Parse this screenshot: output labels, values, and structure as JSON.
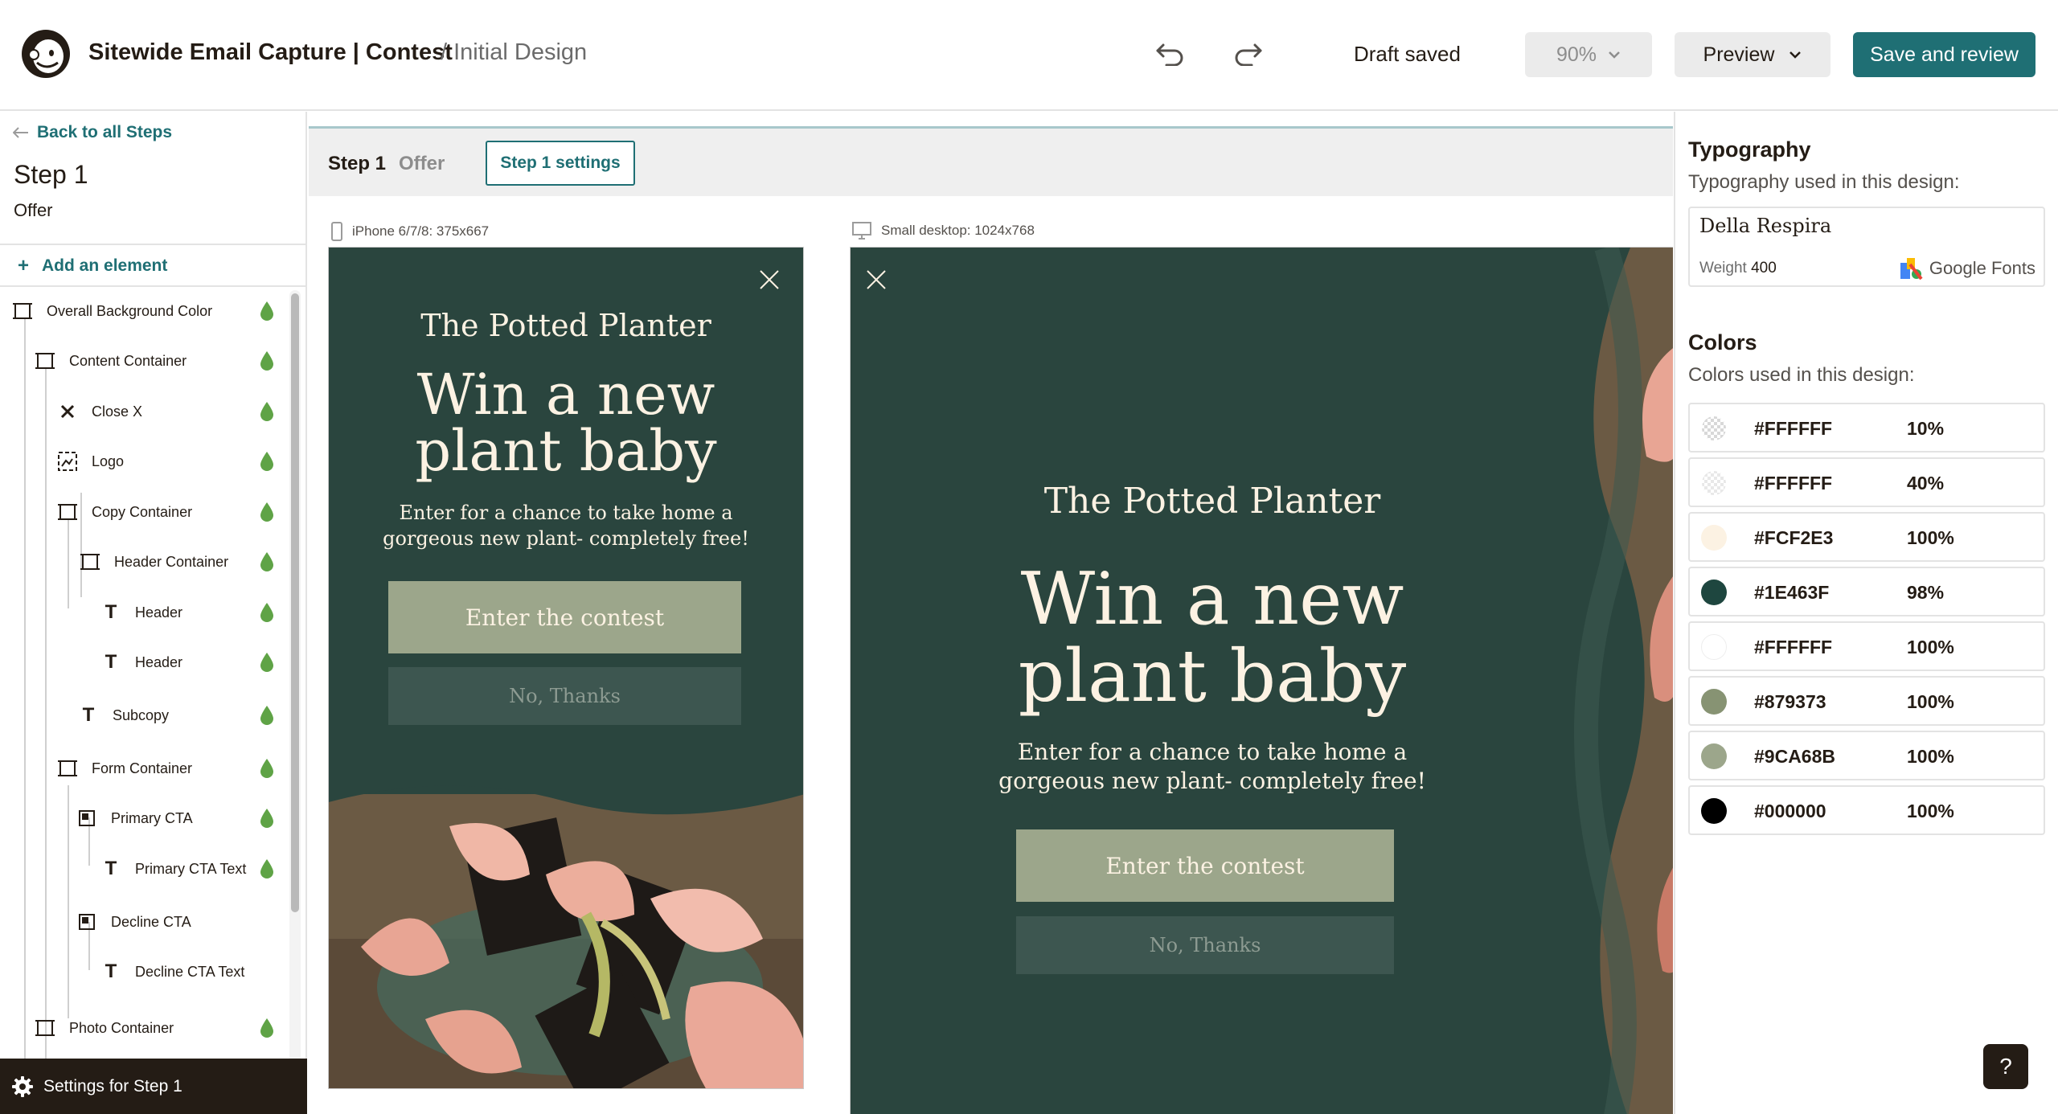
{
  "header": {
    "title": "Sitewide Email Capture | Contest",
    "subtitle": "/ Initial Design",
    "status": "Draft saved",
    "zoom": "90%",
    "preview_label": "Preview",
    "save_label": "Save and review"
  },
  "sidebar": {
    "back_label": "Back to all Steps",
    "step_title": "Step 1",
    "step_subtitle": "Offer",
    "add_label": "Add an element",
    "items": [
      {
        "label": "Overall Background Color"
      },
      {
        "label": "Content Container"
      },
      {
        "label": "Close X"
      },
      {
        "label": "Logo"
      },
      {
        "label": "Copy Container"
      },
      {
        "label": "Header Container"
      },
      {
        "label": "Header"
      },
      {
        "label": "Header"
      },
      {
        "label": "Subcopy"
      },
      {
        "label": "Form Container"
      },
      {
        "label": "Primary CTA"
      },
      {
        "label": "Primary CTA Text"
      },
      {
        "label": "Decline CTA"
      },
      {
        "label": "Decline CTA Text"
      },
      {
        "label": "Photo Container"
      }
    ],
    "settings_label": "Settings for Step 1"
  },
  "canvas": {
    "step_label": "Step 1",
    "step_name": "Offer",
    "settings_button": "Step 1 settings",
    "mobile_label": "iPhone 6/7/8: 375x667",
    "desktop_label": "Small desktop: 1024x768",
    "popup": {
      "brand": "The Potted Planter",
      "headline_line1": "Win a new",
      "headline_line2": "plant baby",
      "subcopy_line1": "Enter for a chance to take home a",
      "subcopy_line2": "gorgeous new plant- completely free!",
      "primary_cta": "Enter the contest",
      "decline_cta": "No, Thanks"
    }
  },
  "right_panel": {
    "typography_title": "Typography",
    "typography_sub": "Typography used in this design:",
    "font_name": "Della Respira",
    "weight_label": "Weight",
    "weight_value": "400",
    "font_source": "Google Fonts",
    "colors_title": "Colors",
    "colors_sub": "Colors used in this design:",
    "colors": [
      {
        "hex": "#FFFFFF",
        "opacity": "10%"
      },
      {
        "hex": "#FFFFFF",
        "opacity": "40%"
      },
      {
        "hex": "#FCF2E3",
        "opacity": "100%"
      },
      {
        "hex": "#1E463F",
        "opacity": "98%"
      },
      {
        "hex": "#FFFFFF",
        "opacity": "100%"
      },
      {
        "hex": "#879373",
        "opacity": "100%"
      },
      {
        "hex": "#9CA68B",
        "opacity": "100%"
      },
      {
        "hex": "#000000",
        "opacity": "100%"
      }
    ]
  },
  "help_label": "?",
  "theme": {
    "accent": "#1f6f74",
    "popup_bg": "#2a453e",
    "cta": "#9ca68b",
    "cream": "#fcf2e3",
    "leaf_green": "#5fa346"
  }
}
